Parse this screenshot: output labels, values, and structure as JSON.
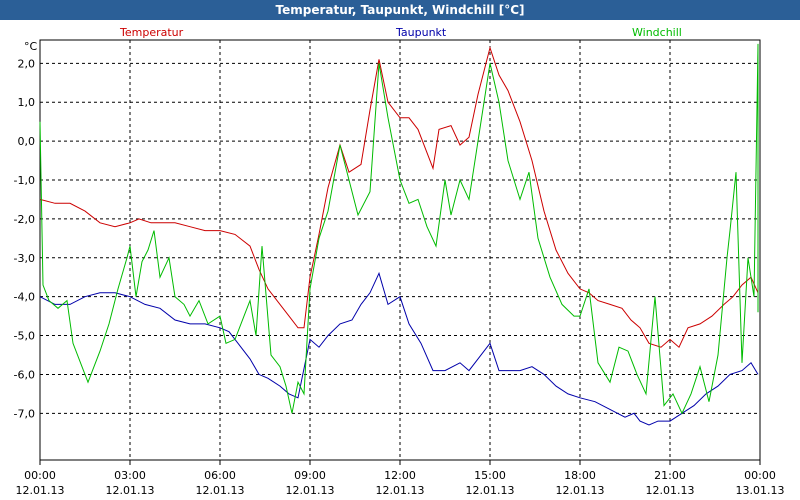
{
  "window": {
    "title": "Temperatur, Taupunkt, Windchill [°C]"
  },
  "chart_data": {
    "type": "line",
    "title": "Temperatur, Taupunkt, Windchill [°C]",
    "ylabel": "°C",
    "ylim": [
      -8.0,
      3.0
    ],
    "xlim": [
      0,
      24
    ],
    "yticks": [
      "2,0",
      "1,0",
      "0,0",
      "-1,0",
      "-2,0",
      "-3,0",
      "-4,0",
      "-5,0",
      "-6,0",
      "-7,0"
    ],
    "ytick_values": [
      2,
      1,
      0,
      -1,
      -2,
      -3,
      -4,
      -5,
      -6,
      -7
    ],
    "xticks": [
      {
        "time": "00:00",
        "date": "12.01.13"
      },
      {
        "time": "03:00",
        "date": "12.01.13"
      },
      {
        "time": "06:00",
        "date": "12.01.13"
      },
      {
        "time": "09:00",
        "date": "12.01.13"
      },
      {
        "time": "12:00",
        "date": "12.01.13"
      },
      {
        "time": "15:00",
        "date": "12.01.13"
      },
      {
        "time": "18:00",
        "date": "12.01.13"
      },
      {
        "time": "21:00",
        "date": "12.01.13"
      },
      {
        "time": "00:00",
        "date": "13.01.13"
      }
    ],
    "grid": true,
    "series": [
      {
        "name": "Temperatur",
        "color": "#cc0000",
        "points": [
          [
            0,
            -1.5
          ],
          [
            0.5,
            -1.6
          ],
          [
            1,
            -1.6
          ],
          [
            1.5,
            -1.8
          ],
          [
            2,
            -2.1
          ],
          [
            2.5,
            -2.2
          ],
          [
            3,
            -2.1
          ],
          [
            3.3,
            -2.0
          ],
          [
            3.7,
            -2.1
          ],
          [
            4,
            -2.1
          ],
          [
            4.5,
            -2.1
          ],
          [
            5,
            -2.2
          ],
          [
            5.5,
            -2.3
          ],
          [
            6,
            -2.3
          ],
          [
            6.5,
            -2.4
          ],
          [
            7,
            -2.7
          ],
          [
            7.3,
            -3.3
          ],
          [
            7.6,
            -3.8
          ],
          [
            8,
            -4.2
          ],
          [
            8.3,
            -4.5
          ],
          [
            8.6,
            -4.8
          ],
          [
            8.8,
            -4.8
          ],
          [
            9,
            -3.5
          ],
          [
            9.3,
            -2.4
          ],
          [
            9.6,
            -1.2
          ],
          [
            10,
            -0.1
          ],
          [
            10.3,
            -0.8
          ],
          [
            10.7,
            -0.6
          ],
          [
            11,
            0.8
          ],
          [
            11.3,
            2.1
          ],
          [
            11.6,
            1.0
          ],
          [
            12,
            0.6
          ],
          [
            12.3,
            0.6
          ],
          [
            12.6,
            0.3
          ],
          [
            13.1,
            -0.7
          ],
          [
            13.3,
            0.3
          ],
          [
            13.7,
            0.4
          ],
          [
            14,
            -0.1
          ],
          [
            14.3,
            0.1
          ],
          [
            14.6,
            1.2
          ],
          [
            15,
            2.4
          ],
          [
            15.3,
            1.7
          ],
          [
            15.6,
            1.3
          ],
          [
            16,
            0.5
          ],
          [
            16.4,
            -0.5
          ],
          [
            16.8,
            -1.8
          ],
          [
            17.2,
            -2.8
          ],
          [
            17.6,
            -3.4
          ],
          [
            18,
            -3.8
          ],
          [
            18.3,
            -3.9
          ],
          [
            18.6,
            -4.1
          ],
          [
            19,
            -4.2
          ],
          [
            19.4,
            -4.3
          ],
          [
            19.7,
            -4.6
          ],
          [
            20,
            -4.8
          ],
          [
            20.3,
            -5.2
          ],
          [
            20.7,
            -5.3
          ],
          [
            21,
            -5.1
          ],
          [
            21.3,
            -5.3
          ],
          [
            21.6,
            -4.8
          ],
          [
            22,
            -4.7
          ],
          [
            22.4,
            -4.5
          ],
          [
            22.8,
            -4.2
          ],
          [
            23.1,
            -4.0
          ],
          [
            23.4,
            -3.7
          ],
          [
            23.7,
            -3.5
          ],
          [
            24,
            -3.9
          ]
        ]
      },
      {
        "name": "Taupunkt",
        "color": "#0000aa",
        "points": [
          [
            0,
            -4.0
          ],
          [
            0.5,
            -4.2
          ],
          [
            1,
            -4.2
          ],
          [
            1.5,
            -4.0
          ],
          [
            2,
            -3.9
          ],
          [
            2.5,
            -3.9
          ],
          [
            3,
            -4.0
          ],
          [
            3.5,
            -4.2
          ],
          [
            4,
            -4.3
          ],
          [
            4.5,
            -4.6
          ],
          [
            5,
            -4.7
          ],
          [
            5.5,
            -4.7
          ],
          [
            6,
            -4.8
          ],
          [
            6.3,
            -4.9
          ],
          [
            6.6,
            -5.2
          ],
          [
            7,
            -5.6
          ],
          [
            7.3,
            -6.0
          ],
          [
            7.6,
            -6.1
          ],
          [
            8,
            -6.3
          ],
          [
            8.3,
            -6.5
          ],
          [
            8.6,
            -6.6
          ],
          [
            9,
            -5.1
          ],
          [
            9.3,
            -5.3
          ],
          [
            9.6,
            -5.0
          ],
          [
            10,
            -4.7
          ],
          [
            10.4,
            -4.6
          ],
          [
            10.7,
            -4.2
          ],
          [
            11,
            -3.9
          ],
          [
            11.3,
            -3.4
          ],
          [
            11.6,
            -4.2
          ],
          [
            12,
            -4.0
          ],
          [
            12.3,
            -4.7
          ],
          [
            12.7,
            -5.2
          ],
          [
            13.1,
            -5.9
          ],
          [
            13.5,
            -5.9
          ],
          [
            14,
            -5.7
          ],
          [
            14.3,
            -5.9
          ],
          [
            14.6,
            -5.6
          ],
          [
            15,
            -5.2
          ],
          [
            15.3,
            -5.9
          ],
          [
            15.7,
            -5.9
          ],
          [
            16,
            -5.9
          ],
          [
            16.4,
            -5.8
          ],
          [
            16.8,
            -6.0
          ],
          [
            17.2,
            -6.3
          ],
          [
            17.6,
            -6.5
          ],
          [
            18,
            -6.6
          ],
          [
            18.5,
            -6.7
          ],
          [
            19,
            -6.9
          ],
          [
            19.5,
            -7.1
          ],
          [
            19.8,
            -7.0
          ],
          [
            20,
            -7.2
          ],
          [
            20.3,
            -7.3
          ],
          [
            20.6,
            -7.2
          ],
          [
            21,
            -7.2
          ],
          [
            21.4,
            -7.0
          ],
          [
            21.8,
            -6.8
          ],
          [
            22.2,
            -6.5
          ],
          [
            22.6,
            -6.3
          ],
          [
            23,
            -6.0
          ],
          [
            23.4,
            -5.9
          ],
          [
            23.7,
            -5.7
          ],
          [
            24,
            -6.0
          ]
        ]
      },
      {
        "name": "Windchill",
        "color": "#00bb00",
        "points": [
          [
            0,
            0.5
          ],
          [
            0.1,
            -3.7
          ],
          [
            0.3,
            -4.1
          ],
          [
            0.6,
            -4.3
          ],
          [
            0.9,
            -4.1
          ],
          [
            1.1,
            -5.2
          ],
          [
            1.4,
            -5.8
          ],
          [
            1.6,
            -6.2
          ],
          [
            2,
            -5.4
          ],
          [
            2.3,
            -4.7
          ],
          [
            2.6,
            -3.8
          ],
          [
            2.9,
            -3.0
          ],
          [
            3,
            -2.7
          ],
          [
            3.2,
            -4.0
          ],
          [
            3.4,
            -3.1
          ],
          [
            3.6,
            -2.8
          ],
          [
            3.8,
            -2.3
          ],
          [
            4,
            -3.5
          ],
          [
            4.3,
            -3.0
          ],
          [
            4.5,
            -4.0
          ],
          [
            4.8,
            -4.2
          ],
          [
            5,
            -4.5
          ],
          [
            5.3,
            -4.1
          ],
          [
            5.6,
            -4.7
          ],
          [
            6,
            -4.5
          ],
          [
            6.2,
            -5.2
          ],
          [
            6.5,
            -5.1
          ],
          [
            6.8,
            -4.5
          ],
          [
            7,
            -4.1
          ],
          [
            7.2,
            -5.0
          ],
          [
            7.4,
            -2.7
          ],
          [
            7.7,
            -5.5
          ],
          [
            8,
            -5.8
          ],
          [
            8.2,
            -6.3
          ],
          [
            8.4,
            -7.0
          ],
          [
            8.6,
            -6.2
          ],
          [
            8.8,
            -6.5
          ],
          [
            9,
            -3.8
          ],
          [
            9.3,
            -2.5
          ],
          [
            9.6,
            -1.8
          ],
          [
            10,
            -0.1
          ],
          [
            10.3,
            -1.0
          ],
          [
            10.6,
            -1.9
          ],
          [
            11,
            -1.3
          ],
          [
            11.3,
            2.0
          ],
          [
            11.6,
            0.6
          ],
          [
            12,
            -1.0
          ],
          [
            12.3,
            -1.6
          ],
          [
            12.6,
            -1.5
          ],
          [
            12.9,
            -2.2
          ],
          [
            13.2,
            -2.7
          ],
          [
            13.5,
            -1.0
          ],
          [
            13.7,
            -1.9
          ],
          [
            14,
            -1.0
          ],
          [
            14.3,
            -1.5
          ],
          [
            14.6,
            0.0
          ],
          [
            15,
            2.0
          ],
          [
            15.3,
            1.0
          ],
          [
            15.6,
            -0.5
          ],
          [
            16,
            -1.5
          ],
          [
            16.3,
            -0.8
          ],
          [
            16.6,
            -2.5
          ],
          [
            17,
            -3.5
          ],
          [
            17.4,
            -4.2
          ],
          [
            17.8,
            -4.5
          ],
          [
            18,
            -4.5
          ],
          [
            18.3,
            -3.8
          ],
          [
            18.6,
            -5.7
          ],
          [
            19,
            -6.2
          ],
          [
            19.3,
            -5.3
          ],
          [
            19.6,
            -5.4
          ],
          [
            19.9,
            -6.0
          ],
          [
            20.2,
            -6.5
          ],
          [
            20.5,
            -4.0
          ],
          [
            20.8,
            -6.8
          ],
          [
            21.1,
            -6.5
          ],
          [
            21.4,
            -7.0
          ],
          [
            21.7,
            -6.5
          ],
          [
            22,
            -5.8
          ],
          [
            22.3,
            -6.7
          ],
          [
            22.6,
            -5.5
          ],
          [
            22.9,
            -3.0
          ],
          [
            23,
            -2.3
          ],
          [
            23.2,
            -0.8
          ],
          [
            23.4,
            -5.7
          ],
          [
            23.6,
            -3.0
          ],
          [
            23.8,
            -4.0
          ],
          [
            24,
            2.5
          ],
          [
            24.2,
            -4.0
          ],
          [
            24.3,
            -4.4
          ]
        ]
      }
    ],
    "legend": [
      "Temperatur",
      "Taupunkt",
      "Windchill"
    ]
  }
}
